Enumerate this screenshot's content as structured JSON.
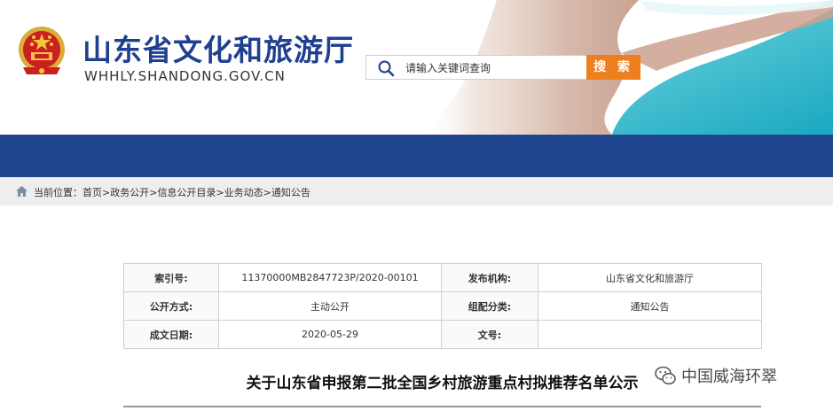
{
  "header": {
    "site_name": "山东省文化和旅游厅",
    "site_url": "WHHLY.SHANDONG.GOV.CN",
    "search_placeholder": "请输入关键词查询",
    "search_button": "搜 索"
  },
  "breadcrumb": {
    "label": "当前位置：",
    "items": [
      "首页",
      "政务公开",
      "信息公开目录",
      "业务动态",
      "通知公告"
    ],
    "separator": ">"
  },
  "meta": [
    {
      "k1": "索引号:",
      "v1": "11370000MB2847723P/2020-00101",
      "k2": "发布机构:",
      "v2": "山东省文化和旅游厅"
    },
    {
      "k1": "公开方式:",
      "v1": "主动公开",
      "k2": "组配分类:",
      "v2": "通知公告"
    },
    {
      "k1": "成文日期:",
      "v1": "2020-05-29",
      "k2": "文号:",
      "v2": ""
    }
  ],
  "article": {
    "title": "关于山东省申报第二批全国乡村旅游重点村拟推荐名单公示"
  },
  "watermark": {
    "text": "中国威海环翠"
  },
  "colors": {
    "brand_blue": "#20458f",
    "search_orange": "#ee7f1e",
    "title_blue": "#1f3f8f"
  }
}
